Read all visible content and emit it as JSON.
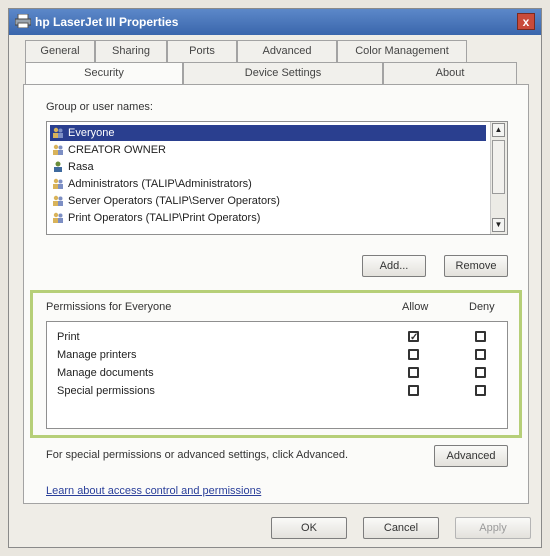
{
  "window": {
    "title": "hp LaserJet III Properties",
    "close_label": "x"
  },
  "tabs_row1": [
    "General",
    "Sharing",
    "Ports",
    "Advanced",
    "Color Management"
  ],
  "tabs_row2": [
    "Security",
    "Device Settings",
    "About"
  ],
  "active_tab": "Security",
  "group_label": "Group or user names:",
  "users": [
    {
      "name": "Everyone",
      "selected": true,
      "icon": "group-icon"
    },
    {
      "name": "CREATOR OWNER",
      "selected": false,
      "icon": "group-icon"
    },
    {
      "name": "Rasa",
      "selected": false,
      "icon": "user-icon"
    },
    {
      "name": "Administrators (TALIP\\Administrators)",
      "selected": false,
      "icon": "group-icon"
    },
    {
      "name": "Server Operators (TALIP\\Server Operators)",
      "selected": false,
      "icon": "group-icon"
    },
    {
      "name": "Print Operators (TALIP\\Print Operators)",
      "selected": false,
      "icon": "group-icon"
    }
  ],
  "buttons": {
    "add": "Add...",
    "remove": "Remove",
    "advanced": "Advanced",
    "ok": "OK",
    "cancel": "Cancel",
    "apply": "Apply"
  },
  "permissions": {
    "header": "Permissions for Everyone",
    "allow_label": "Allow",
    "deny_label": "Deny",
    "rows": [
      {
        "name": "Print",
        "allow": true,
        "deny": false
      },
      {
        "name": "Manage printers",
        "allow": false,
        "deny": false
      },
      {
        "name": "Manage documents",
        "allow": false,
        "deny": false
      },
      {
        "name": "Special permissions",
        "allow": false,
        "deny": false
      }
    ]
  },
  "special_text": "For special permissions or advanced settings, click Advanced.",
  "learn_link": "Learn about access control and permissions",
  "colors": {
    "title_bar": "#3a66ac",
    "selection": "#2a3f8f",
    "highlight_frame": "#b6cf78",
    "link": "#2a3f9a"
  }
}
